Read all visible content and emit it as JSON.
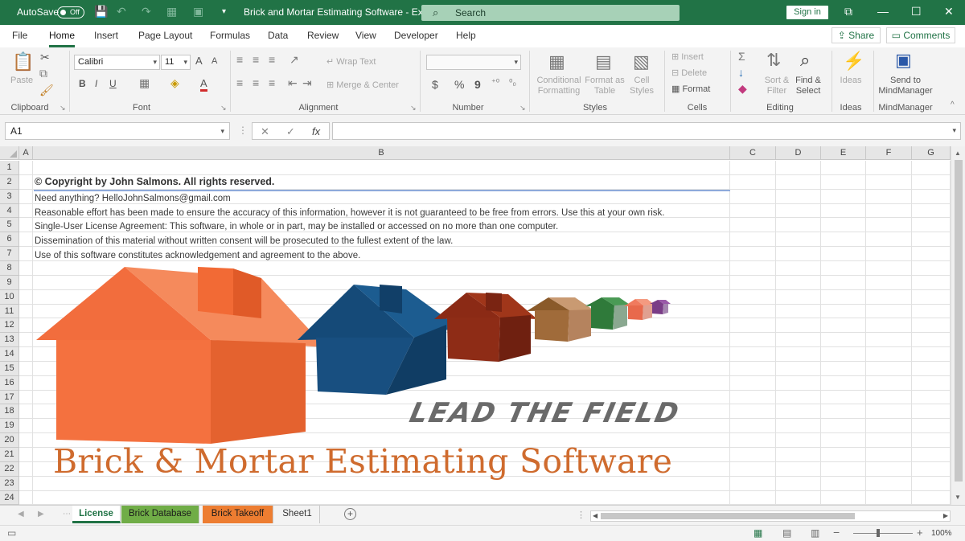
{
  "titlebar": {
    "autosave_label": "AutoSave",
    "autosave_state": "Off",
    "document_title": "Brick and Mortar Estimating Software  -  Ex...",
    "search_placeholder": "Search",
    "signin_label": "Sign in",
    "accent_color": "#217346"
  },
  "ribbon_tabs": [
    "File",
    "Home",
    "Insert",
    "Page Layout",
    "Formulas",
    "Data",
    "Review",
    "View",
    "Developer",
    "Help"
  ],
  "active_tab": "Home",
  "share_label": "Share",
  "comments_label": "Comments",
  "ribbon": {
    "clipboard": {
      "paste": "Paste",
      "label": "Clipboard"
    },
    "font": {
      "name": "Calibri",
      "size": "11",
      "bold": "B",
      "italic": "I",
      "underline": "U",
      "grow": "A",
      "shrink": "A",
      "label": "Font"
    },
    "alignment": {
      "wrap": "Wrap Text",
      "merge": "Merge & Center",
      "label": "Alignment"
    },
    "number": {
      "currency": "$",
      "percent": "%",
      "comma": "9",
      "label": "Number"
    },
    "styles": {
      "conditional_1": "Conditional",
      "conditional_2": "Formatting",
      "format_table_1": "Format as",
      "format_table_2": "Table",
      "cell_styles_1": "Cell",
      "cell_styles_2": "Styles",
      "label": "Styles"
    },
    "cells": {
      "insert": "Insert",
      "delete": "Delete",
      "format": "Format",
      "label": "Cells"
    },
    "editing": {
      "sort_1": "Sort &",
      "sort_2": "Filter",
      "find_1": "Find &",
      "find_2": "Select",
      "label": "Editing"
    },
    "ideas": {
      "button": "Ideas",
      "label": "Ideas"
    },
    "mindmanager": {
      "button_1": "Send to",
      "button_2": "MindManager",
      "label": "MindManager"
    }
  },
  "formula_bar": {
    "name_box": "A1",
    "cancel": "✕",
    "enter": "✓",
    "fx": "fx",
    "value": ""
  },
  "columns": [
    "A",
    "B",
    "C",
    "D",
    "E",
    "F",
    "G"
  ],
  "rows": [
    "1",
    "2",
    "3",
    "4",
    "5",
    "6",
    "7",
    "8",
    "9",
    "10",
    "11",
    "12",
    "13",
    "14",
    "15",
    "16",
    "17",
    "18",
    "19",
    "20",
    "21",
    "22",
    "23",
    "24"
  ],
  "cells": {
    "copyright": "© Copyright by John Salmons. All rights reserved.",
    "contact": "Need anything? HelloJohnSalmons@gmail.com",
    "accuracy": "Reasonable effort has been made to ensure the accuracy of this information, however it is not guaranteed to be free from errors. Use this at your own risk.",
    "license": "Single-User License Agreement: This software, in whole or in part, may be installed or accessed on no more than one computer.",
    "dissemination": "Dissemination of this material without written consent will be prosecuted to the fullest extent of the law.",
    "acknowledgement": "Use of this software constitutes acknowledgement and agreement to the above."
  },
  "banner": {
    "tagline": "LEAD THE FIELD",
    "product_name": "Brick & Mortar Estimating Software",
    "house_colors": [
      "#f26d3d",
      "#154a78",
      "#8b2a15",
      "#b5835e",
      "#2f7a3a",
      "#f07a5e",
      "#7a3d87"
    ]
  },
  "sheet_tabs": [
    {
      "label": "License",
      "color": "#ffffff",
      "active": true
    },
    {
      "label": "Brick Database",
      "color": "#70ad47",
      "active": false
    },
    {
      "label": "Brick Takeoff",
      "color": "#ed7d31",
      "active": false
    },
    {
      "label": "Sheet1",
      "color": "#f3f3f3",
      "active": false
    }
  ],
  "status": {
    "zoom": "100%",
    "minus": "−",
    "plus": "+"
  }
}
